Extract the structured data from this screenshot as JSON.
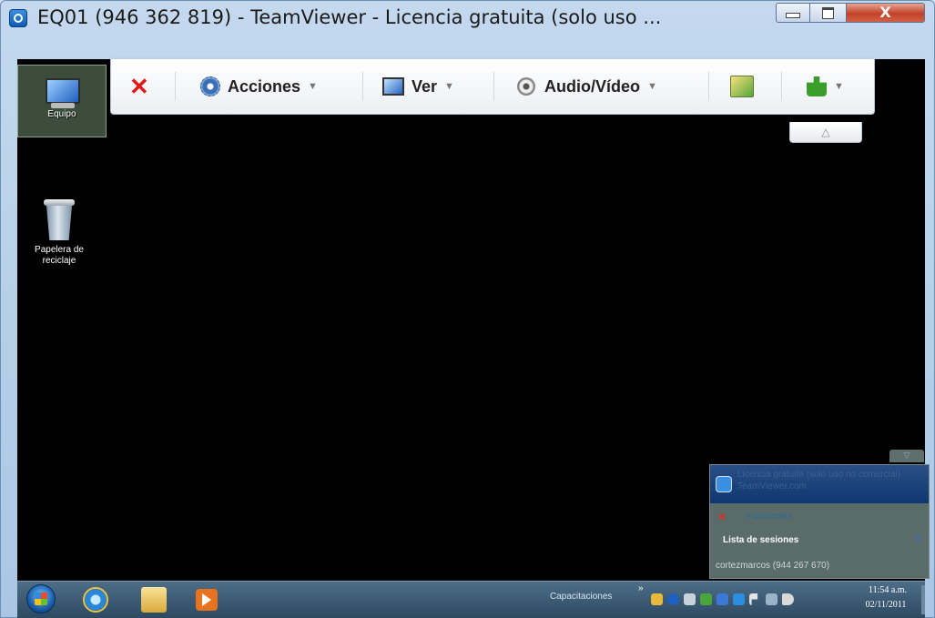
{
  "window": {
    "title": "EQ01 (946 362 819) - TeamViewer - Licencia gratuita (solo uso ...",
    "minimize_glyph": "",
    "maximize_glyph": "",
    "close_glyph": "X"
  },
  "toolbar": {
    "close_label": "✕",
    "actions_label": "Acciones",
    "view_label": "Ver",
    "audio_video_label": "Audio/Vídeo",
    "dropdown_caret": "▼",
    "collapse_glyph": "△"
  },
  "desktop": {
    "icons": [
      {
        "label": "Equipo",
        "icon": "computer-icon"
      },
      {
        "label": "Papelera de reciclaje",
        "icon": "recycle-bin-icon"
      }
    ]
  },
  "tv_panel": {
    "toggle_glyph": "▽",
    "header_line1": "Licencia gratuita (solo uso no comercial)",
    "header_line2": "TeamViewer.com",
    "close_label": "✕",
    "functions_label": "Funciones",
    "sessions_title": "Lista de sesiones",
    "sessions_close": "✕",
    "session_entry": "cortezmarcos (944 267 670)"
  },
  "taskbar": {
    "tray_label": "Capacitaciones",
    "tray_chevron": "»",
    "time": "11:54 a.m.",
    "date": "02/11/2011"
  },
  "colors": {
    "desktop_bg": "#000000",
    "titlebar": "#b9d1ea",
    "close_button": "#c24128",
    "toolbar_close": "#e01818",
    "taskbar": "#3c5a72"
  }
}
